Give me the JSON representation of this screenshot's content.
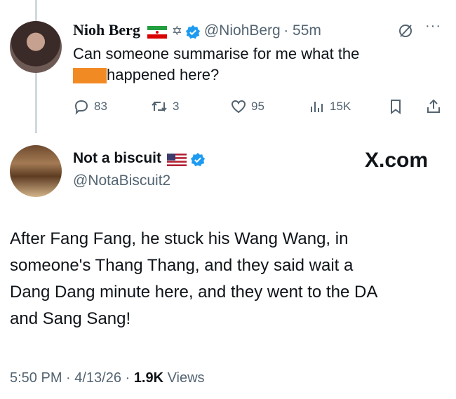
{
  "tweet1": {
    "display_name": "Nioh Berg",
    "handle": "@NiohBerg",
    "time": "· 55m",
    "text_line1": "Can someone summarise for me what the",
    "text_line2": "happened here?",
    "actions": {
      "replies": "83",
      "reposts": "3",
      "likes": "95",
      "views": "15K"
    }
  },
  "tweet2": {
    "display_name": "Not a biscuit",
    "handle": "@NotaBiscuit2",
    "watermark": "X.com",
    "body_lines": [
      "After Fang Fang, he stuck his Wang Wang, in",
      "someone's Thang Thang, and they said wait a",
      "Dang Dang minute here, and they went to the DA",
      "and Sang Sang!"
    ],
    "footer": {
      "time": "5:50 PM · 4/13/26 · ",
      "views_count": "1.9K",
      "views_label": " Views"
    }
  },
  "colors": {
    "secondary_text": "#536471",
    "verified_blue": "#1d9bf0",
    "redaction": "#f28a24"
  }
}
